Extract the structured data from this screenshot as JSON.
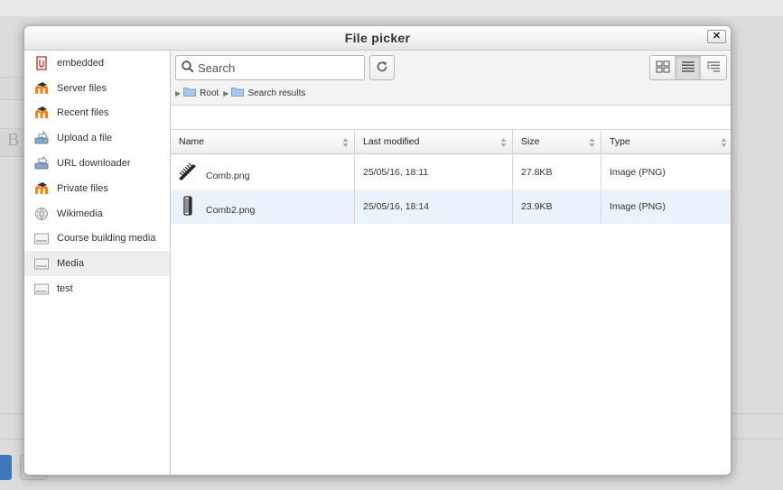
{
  "dialog": {
    "title": "File picker",
    "close_label": "✕"
  },
  "background": {
    "editor_bold": "B"
  },
  "sidebar": {
    "items": [
      {
        "label": "embedded",
        "icon": "embedded-icon"
      },
      {
        "label": "Server files",
        "icon": "moodle-icon"
      },
      {
        "label": "Recent files",
        "icon": "moodle-icon"
      },
      {
        "label": "Upload a file",
        "icon": "upload-icon"
      },
      {
        "label": "URL downloader",
        "icon": "url-download-icon"
      },
      {
        "label": "Private files",
        "icon": "moodle-icon"
      },
      {
        "label": "Wikimedia",
        "icon": "wikimedia-icon"
      },
      {
        "label": "Course building media",
        "icon": "repository-icon"
      },
      {
        "label": "Media",
        "icon": "repository-icon",
        "active": true
      },
      {
        "label": "test",
        "icon": "repository-icon"
      }
    ]
  },
  "toolbar": {
    "search_placeholder": "Search",
    "refresh_icon": "refresh-icon",
    "views": [
      "icons-view-icon",
      "list-view-icon",
      "tree-view-icon"
    ],
    "active_view": "list-view-icon"
  },
  "breadcrumb": {
    "items": [
      "Root",
      "Search results"
    ]
  },
  "table": {
    "headers": {
      "name": "Name",
      "modified": "Last modified",
      "size": "Size",
      "type": "Type"
    },
    "rows": [
      {
        "name": "Comb.png",
        "modified": "25/05/16, 18:11",
        "size": "27.8KB",
        "type": "Image (PNG)",
        "icon": "comb-thumbnail-icon"
      },
      {
        "name": "Comb2.png",
        "modified": "25/05/16, 18:14",
        "size": "23.9KB",
        "type": "Image (PNG)",
        "icon": "comb2-thumbnail-icon",
        "selected": true
      }
    ]
  },
  "colors": {
    "selected_row": "#eaf3fc",
    "active_sidebar": "#eeeeee",
    "moodle_orange": "#f98012"
  }
}
